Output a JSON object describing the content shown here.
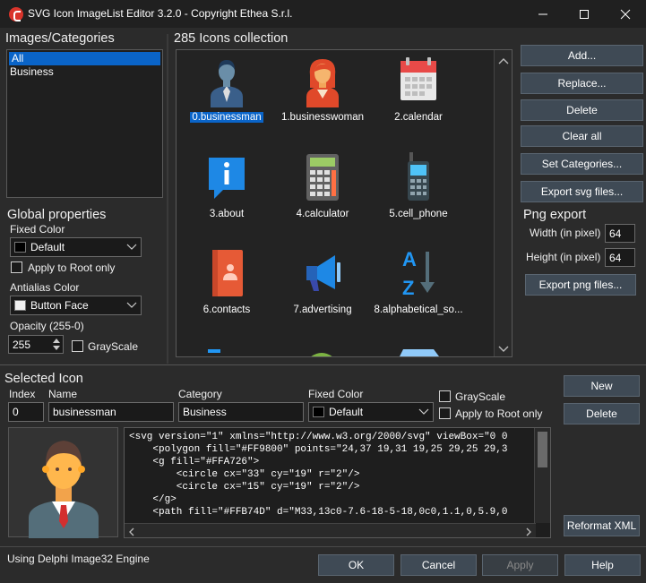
{
  "window": {
    "title": "SVG Icon ImageList Editor 3.2.0 - Copyright Ethea S.r.l."
  },
  "categories": {
    "title": "Images/Categories",
    "items": [
      {
        "label": "All"
      },
      {
        "label": "Business"
      }
    ],
    "selected": "All"
  },
  "global": {
    "title": "Global properties",
    "fixed_color_label": "Fixed Color",
    "fixed_color_value": "Default",
    "apply_root_label": "Apply to Root only",
    "antialias_label": "Antialias Color",
    "antialias_value": "Button Face",
    "opacity_label": "Opacity (255-0)",
    "opacity_value": "255",
    "grayscale_label": "GrayScale"
  },
  "collection": {
    "title": "285 Icons collection",
    "icons": [
      {
        "label": "0.businessman",
        "icon": "businessman-icon",
        "selected": true
      },
      {
        "label": "1.businesswoman",
        "icon": "businesswoman-icon"
      },
      {
        "label": "2.calendar",
        "icon": "calendar-icon"
      },
      {
        "label": "3.about",
        "icon": "about-icon"
      },
      {
        "label": "4.calculator",
        "icon": "calculator-icon"
      },
      {
        "label": "5.cell_phone",
        "icon": "cell-phone-icon"
      },
      {
        "label": "6.contacts",
        "icon": "contacts-icon"
      },
      {
        "label": "7.advertising",
        "icon": "advertising-icon"
      },
      {
        "label": "8.alphabetical_so...",
        "icon": "alphabetical-sort-icon"
      }
    ]
  },
  "actions": {
    "add": "Add...",
    "replace": "Replace...",
    "delete": "Delete",
    "clear_all": "Clear all",
    "set_categories": "Set Categories...",
    "export_svg": "Export svg files..."
  },
  "png_export": {
    "title": "Png export",
    "width_label": "Width (in pixel)",
    "width_value": "64",
    "height_label": "Height (in pixel)",
    "height_value": "64",
    "export_png": "Export png files..."
  },
  "selected_icon": {
    "title": "Selected Icon",
    "index_label": "Index",
    "index_value": "0",
    "name_label": "Name",
    "name_value": "businessman",
    "category_label": "Category",
    "category_value": "Business",
    "fixed_color_label": "Fixed Color",
    "fixed_color_value": "Default",
    "grayscale_label": "GrayScale",
    "apply_root_label": "Apply to Root only",
    "new": "New",
    "delete": "Delete",
    "reformat_xml": "Reformat XML",
    "code_lines": [
      "<svg version=\"1\" xmlns=\"http://www.w3.org/2000/svg\" viewBox=\"0 0",
      "    <polygon fill=\"#FF9800\" points=\"24,37 19,31 19,25 29,25 29,3",
      "    <g fill=\"#FFA726\">",
      "        <circle cx=\"33\" cy=\"19\" r=\"2\"/>",
      "        <circle cx=\"15\" cy=\"19\" r=\"2\"/>",
      "    </g>",
      "    <path fill=\"#FFB74D\" d=\"M33,13c0-7.6-18-5-18,0c0,1.1,0,5.9,0"
    ]
  },
  "status": {
    "text": "Using Delphi Image32 Engine"
  },
  "footer": {
    "ok": "OK",
    "cancel": "Cancel",
    "apply": "Apply",
    "help": "Help"
  },
  "colors": {
    "accent": "#0a64c8",
    "button": "#3f4a55",
    "background": "#2b2b2b"
  }
}
